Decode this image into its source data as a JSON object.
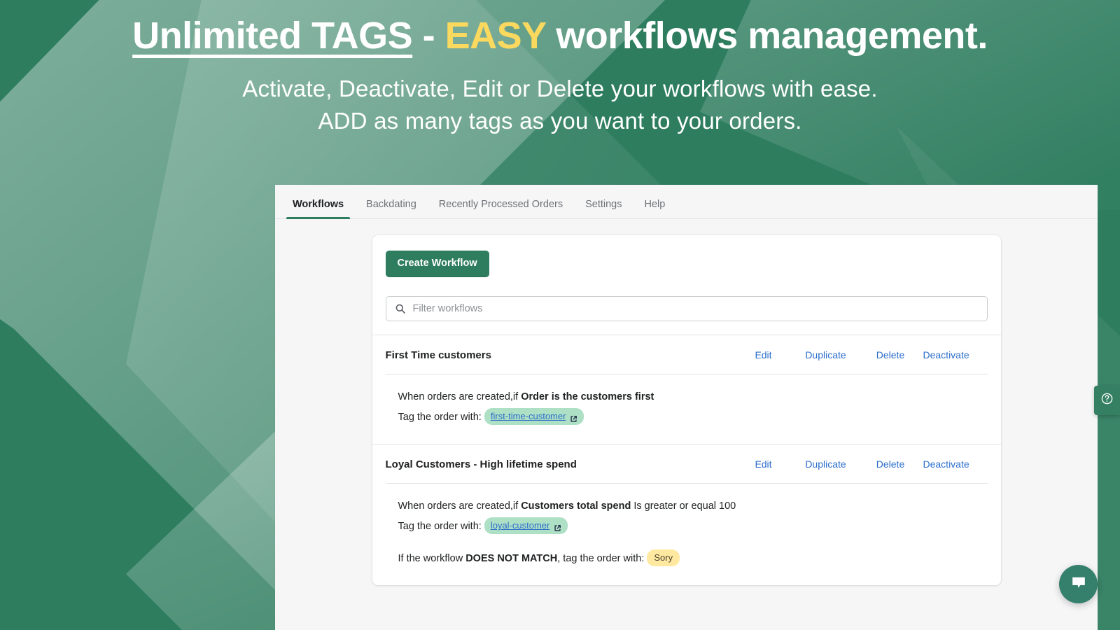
{
  "hero": {
    "title_part1": "Unlimited TAGS",
    "title_dash": " - ",
    "title_accent": "EASY",
    "title_rest": " workflows management.",
    "subtitle_line1": "Activate, Deactivate, Edit or Delete your workflows with ease.",
    "subtitle_line2": "ADD as many tags as you want to your orders.",
    "accent_color": "#FBD95F",
    "background_color": "#2E7D5F"
  },
  "app": {
    "tabs": [
      {
        "label": "Workflows",
        "active": true
      },
      {
        "label": "Backdating",
        "active": false
      },
      {
        "label": "Recently Processed Orders",
        "active": false
      },
      {
        "label": "Settings",
        "active": false
      },
      {
        "label": "Help",
        "active": false
      }
    ],
    "primary_button": "Create Workflow",
    "search": {
      "placeholder": "Filter workflows",
      "value": "",
      "icon": "search-icon"
    },
    "action_labels": {
      "edit": "Edit",
      "duplicate": "Duplicate",
      "delete": "Delete",
      "deactivate": "Deactivate"
    },
    "workflows": [
      {
        "title": "First Time customers",
        "trigger_prefix": "When orders are created,if ",
        "trigger_condition": "Order is the customers first",
        "trigger_suffix": "",
        "tag_label": "Tag the order with:",
        "tag": "first-time-customer",
        "tag_icon": "external-link-icon",
        "no_match_line": null,
        "no_match_tag": null
      },
      {
        "title": "Loyal Customers - High lifetime spend",
        "trigger_prefix": "When orders are created,if ",
        "trigger_condition": "Customers total spend",
        "trigger_suffix": " Is greater or equal 100",
        "tag_label": "Tag the order with:",
        "tag": "loyal-customer",
        "tag_icon": "external-link-icon",
        "no_match_prefix": "If the workflow ",
        "no_match_emphasis": "DOES NOT MATCH",
        "no_match_suffix": ", tag the order with:",
        "no_match_tag": "Sory"
      }
    ],
    "help_widget_icon": "question-mark-circle-icon",
    "chat_widget_icon": "chat-bubble-icon",
    "link_color": "#2c6ecb",
    "brand_green": "#2E7D5F",
    "tag_green": "#aee0c5",
    "tag_yellow": "#ffe9a0"
  }
}
